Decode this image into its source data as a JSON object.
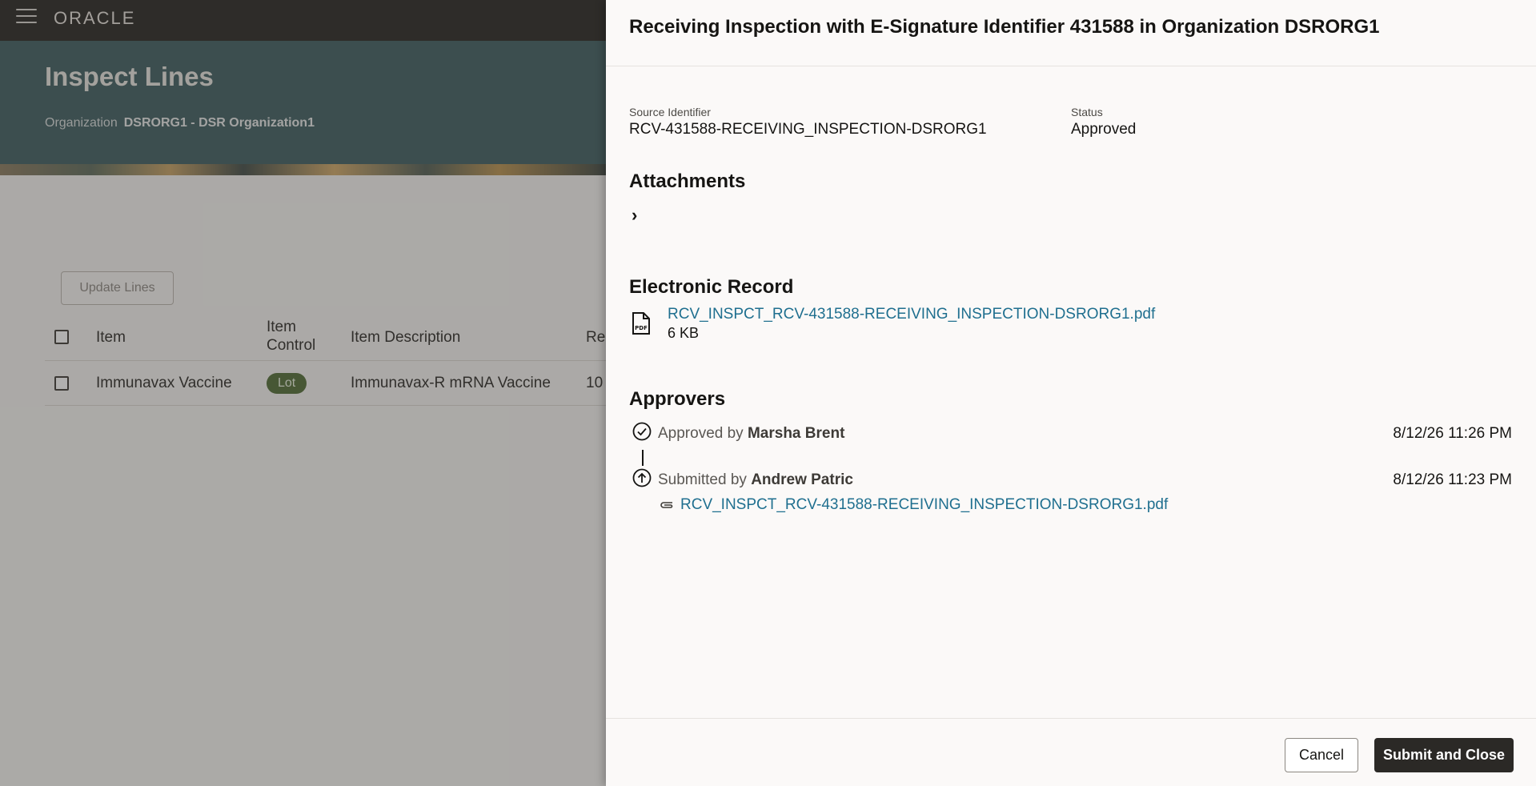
{
  "app": {
    "logo": "ORACLE"
  },
  "page": {
    "title": "Inspect Lines",
    "org_label": "Organization",
    "org_value": "DSRORG1 - DSR Organization1",
    "update_button": "Update Lines",
    "table": {
      "headers": [
        "Item",
        "Item Control",
        "Item Description",
        "Re"
      ],
      "header_item_control_line1": "Item",
      "header_item_control_line2": "Control",
      "row": {
        "item": "Immunavax Vaccine",
        "control": "Lot",
        "description": "Immunavax-R mRNA Vaccine",
        "partial": "10"
      }
    }
  },
  "drawer": {
    "title": "Receiving Inspection with E-Signature Identifier 431588 in Organization DSRORG1",
    "source_label": "Source Identifier",
    "source_value": "RCV-431588-RECEIVING_INSPECTION-DSRORG1",
    "status_label": "Status",
    "status_value": "Approved",
    "attachments_heading": "Attachments",
    "erecord_heading": "Electronic Record",
    "erecord_file": "RCV_INSPCT_RCV-431588-RECEIVING_INSPECTION-DSRORG1.pdf",
    "erecord_size": "6 KB",
    "approvers_heading": "Approvers",
    "approvers": [
      {
        "action": "Approved by",
        "name": "Marsha Brent",
        "date": "8/12/26 11:26 PM",
        "icon": "check-circle-icon"
      },
      {
        "action": "Submitted by",
        "name": "Andrew Patric",
        "date": "8/12/26 11:23 PM",
        "icon": "arrow-up-circle-icon",
        "attachment": "RCV_INSPCT_RCV-431588-RECEIVING_INSPECTION-DSRORG1.pdf"
      }
    ],
    "cancel_button": "Cancel",
    "submit_button": "Submit and Close"
  }
}
